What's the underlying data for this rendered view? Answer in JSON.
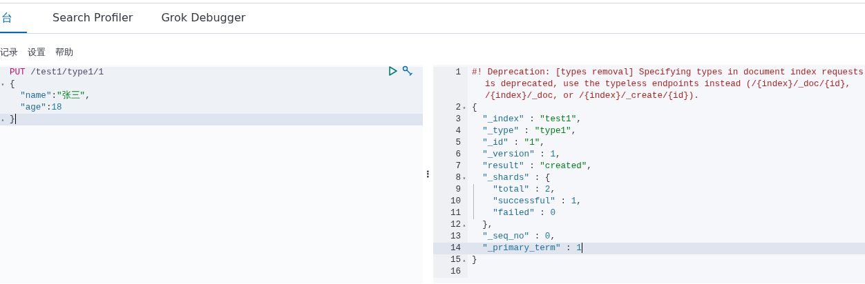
{
  "tabs": [
    {
      "label": "台",
      "selected": true
    },
    {
      "label": "Search Profiler",
      "selected": false
    },
    {
      "label": "Grok Debugger",
      "selected": false
    }
  ],
  "menu": [
    "记录",
    "设置",
    "帮助"
  ],
  "request": {
    "lines": [
      {
        "active": false,
        "tokens": [
          {
            "kind": "method",
            "text": "PUT"
          },
          {
            "kind": "url",
            "text": " /test1/type1/1"
          }
        ]
      },
      {
        "fold": "▾",
        "active": false,
        "tokens": [
          {
            "kind": "punct",
            "text": "{"
          }
        ]
      },
      {
        "active": false,
        "tokens": [
          {
            "kind": "key",
            "text": "  \"name\""
          },
          {
            "kind": "punct",
            "text": ":"
          },
          {
            "kind": "string",
            "text": "\"张三\""
          },
          {
            "kind": "punct",
            "text": ","
          }
        ]
      },
      {
        "active": false,
        "tokens": [
          {
            "kind": "key",
            "text": "  \"age\""
          },
          {
            "kind": "punct",
            "text": ":"
          },
          {
            "kind": "number",
            "text": "18"
          }
        ]
      },
      {
        "fold": "▴",
        "active": true,
        "tokens": [
          {
            "kind": "punct",
            "text": "}"
          }
        ]
      }
    ]
  },
  "resize_handle": "⋮",
  "response": {
    "lines": [
      {
        "number": "1",
        "active": false,
        "tokens": [
          {
            "kind": "warning",
            "text": "#! Deprecation: [types removal] Specifying types in document index requests is deprecated, use the typeless endpoints instead (/{index}/_doc/{id}, /{index}/_doc, or /{index}/_create/{id})."
          }
        ]
      },
      {
        "number": "2",
        "fold": "▾",
        "active": false,
        "tokens": [
          {
            "kind": "punct",
            "text": "{"
          }
        ]
      },
      {
        "number": "3",
        "active": false,
        "tokens": [
          {
            "kind": "key",
            "text": "  \"_index\""
          },
          {
            "kind": "punct",
            "text": " : "
          },
          {
            "kind": "string",
            "text": "\"test1\""
          },
          {
            "kind": "punct",
            "text": ","
          }
        ]
      },
      {
        "number": "4",
        "active": false,
        "tokens": [
          {
            "kind": "key",
            "text": "  \"_type\""
          },
          {
            "kind": "punct",
            "text": " : "
          },
          {
            "kind": "string",
            "text": "\"type1\""
          },
          {
            "kind": "punct",
            "text": ","
          }
        ]
      },
      {
        "number": "5",
        "active": false,
        "tokens": [
          {
            "kind": "key",
            "text": "  \"_id\""
          },
          {
            "kind": "punct",
            "text": " : "
          },
          {
            "kind": "string",
            "text": "\"1\""
          },
          {
            "kind": "punct",
            "text": ","
          }
        ]
      },
      {
        "number": "6",
        "active": false,
        "tokens": [
          {
            "kind": "key",
            "text": "  \"_version\""
          },
          {
            "kind": "punct",
            "text": " : "
          },
          {
            "kind": "number",
            "text": "1"
          },
          {
            "kind": "punct",
            "text": ","
          }
        ]
      },
      {
        "number": "7",
        "active": false,
        "tokens": [
          {
            "kind": "key",
            "text": "  \"result\""
          },
          {
            "kind": "punct",
            "text": " : "
          },
          {
            "kind": "string",
            "text": "\"created\""
          },
          {
            "kind": "punct",
            "text": ","
          }
        ]
      },
      {
        "number": "8",
        "fold": "▾",
        "active": false,
        "tokens": [
          {
            "kind": "key",
            "text": "  \"_shards\""
          },
          {
            "kind": "punct",
            "text": " : {"
          }
        ]
      },
      {
        "number": "9",
        "guide": true,
        "active": false,
        "tokens": [
          {
            "kind": "key",
            "text": "    \"total\""
          },
          {
            "kind": "punct",
            "text": " : "
          },
          {
            "kind": "number",
            "text": "2"
          },
          {
            "kind": "punct",
            "text": ","
          }
        ]
      },
      {
        "number": "10",
        "guide": true,
        "active": false,
        "tokens": [
          {
            "kind": "key",
            "text": "    \"successful\""
          },
          {
            "kind": "punct",
            "text": " : "
          },
          {
            "kind": "number",
            "text": "1"
          },
          {
            "kind": "punct",
            "text": ","
          }
        ]
      },
      {
        "number": "11",
        "guide": true,
        "active": false,
        "tokens": [
          {
            "kind": "key",
            "text": "    \"failed\""
          },
          {
            "kind": "punct",
            "text": " : "
          },
          {
            "kind": "number",
            "text": "0"
          }
        ]
      },
      {
        "number": "12",
        "fold": "▴",
        "active": false,
        "tokens": [
          {
            "kind": "punct",
            "text": "  },"
          }
        ]
      },
      {
        "number": "13",
        "active": false,
        "tokens": [
          {
            "kind": "key",
            "text": "  \"_seq_no\""
          },
          {
            "kind": "punct",
            "text": " : "
          },
          {
            "kind": "number",
            "text": "0"
          },
          {
            "kind": "punct",
            "text": ","
          }
        ]
      },
      {
        "number": "14",
        "active": true,
        "tokens": [
          {
            "kind": "key",
            "text": "  \"_primary_term\""
          },
          {
            "kind": "punct",
            "text": " : "
          },
          {
            "kind": "number",
            "text": "1"
          }
        ]
      },
      {
        "number": "15",
        "fold": "▴",
        "active": false,
        "tokens": [
          {
            "kind": "punct",
            "text": "}"
          }
        ]
      },
      {
        "number": "16",
        "active": false
      }
    ]
  }
}
